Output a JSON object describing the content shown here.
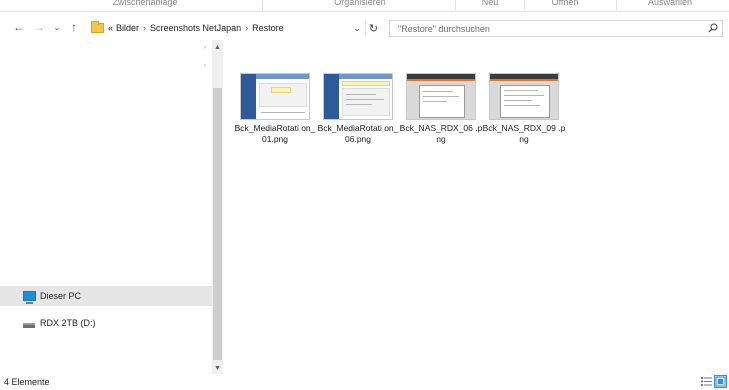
{
  "ribbon": {
    "groups": [
      "Zwischenablage",
      "Organisieren",
      "Neu",
      "Öffnen",
      "Auswählen"
    ]
  },
  "nav": {
    "back_icon": "arrow-left-icon",
    "forward_icon": "arrow-right-icon",
    "recent_icon": "chevron-down-icon",
    "up_icon": "arrow-up-icon"
  },
  "address": {
    "overflow": "«",
    "crumbs": [
      "Bilder",
      "Screenshots NetJapan",
      "Restore"
    ],
    "separator": "›"
  },
  "search": {
    "placeholder": "\"Restore\" durchsuchen"
  },
  "navpane": {
    "items": [
      {
        "label": "Dieser PC",
        "icon": "computer-icon",
        "selected": true
      },
      {
        "label": "RDX 2TB (D:)",
        "icon": "drive-icon",
        "selected": false
      }
    ]
  },
  "files": [
    {
      "name": "Bck_MediaRotation_01.png",
      "label": "Bck_MediaRotati on_01.png",
      "thumb": "media-rotation-screenshot"
    },
    {
      "name": "Bck_MediaRotation_06.png",
      "label": "Bck_MediaRotati on_06.png",
      "thumb": "media-rotation-screenshot"
    },
    {
      "name": "Bck_NAS_RDX_06.png",
      "label": "Bck_NAS_RDX_06 .png",
      "thumb": "nas-rdx-screenshot"
    },
    {
      "name": "Bck_NAS_RDX_09.png",
      "label": "Bck_NAS_RDX_09 .png",
      "thumb": "nas-rdx-screenshot"
    }
  ],
  "status": {
    "count": "4 Elemente"
  },
  "colors": {
    "accent": "#3c8fd6",
    "folder": "#f5c747",
    "selection": "#e5e5e5"
  }
}
